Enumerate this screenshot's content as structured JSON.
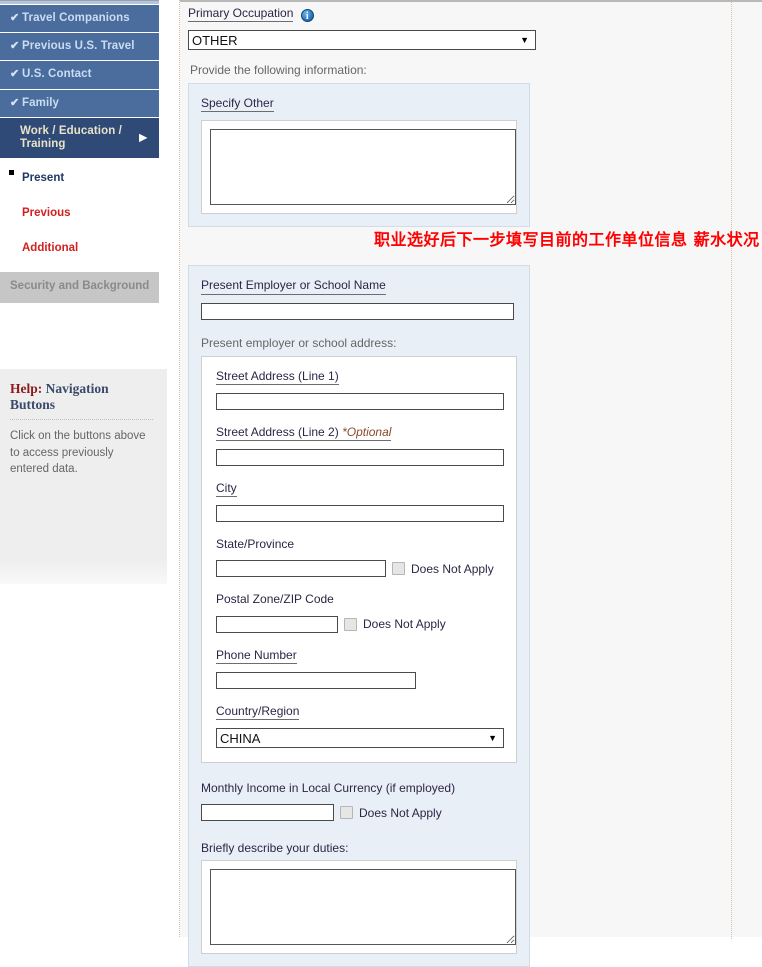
{
  "sidebar": {
    "nav_items": [
      {
        "label": "Travel Companions",
        "check": "✔",
        "state": "complete"
      },
      {
        "label": "Previous U.S. Travel",
        "check": "✔",
        "state": "complete"
      },
      {
        "label": "U.S. Contact",
        "check": "✔",
        "state": "complete"
      },
      {
        "label": "Family",
        "check": "✔",
        "state": "complete"
      },
      {
        "label": "Work / Education / Training",
        "check": "",
        "state": "active",
        "arrow": "▶"
      }
    ],
    "sub_items": [
      {
        "label": "Present",
        "current": true
      },
      {
        "label": "Previous",
        "current": false
      },
      {
        "label": "Additional",
        "current": false
      }
    ],
    "disabled_item": "Security and Background",
    "help": {
      "title_keyword": "Help:",
      "title_rest": " Navigation Buttons",
      "body": "Click on the buttons above to access previously entered data."
    }
  },
  "main": {
    "primary_occupation": {
      "label": "Primary Occupation",
      "info_icon": "i",
      "value": "OTHER",
      "caret": "▼"
    },
    "provide_hint": "Provide the following information:",
    "specify_other": {
      "label": "Specify Other",
      "value": ""
    },
    "annotation_cn": "职业选好后下一步填写目前的工作单位信息 薪水状况 及工作描述",
    "employer_name": {
      "label": "Present Employer or School Name",
      "value": ""
    },
    "address_section_label": "Present employer or school address:",
    "address": {
      "street1": {
        "label": "Street Address (Line 1)",
        "value": ""
      },
      "street2": {
        "label": "Street Address (Line 2)",
        "optional_tag": "*Optional",
        "value": ""
      },
      "city": {
        "label": "City",
        "value": ""
      },
      "state": {
        "label": "State/Province",
        "value": "",
        "dna_label": "Does Not Apply",
        "dna_checked": false
      },
      "postal": {
        "label": "Postal Zone/ZIP Code",
        "value": "",
        "dna_label": "Does Not Apply",
        "dna_checked": false
      },
      "phone": {
        "label": "Phone Number",
        "value": ""
      },
      "country": {
        "label": "Country/Region",
        "value": "CHINA",
        "caret": "▼"
      }
    },
    "monthly_income": {
      "label": "Monthly Income in Local Currency (if employed)",
      "value": "",
      "dna_label": "Does Not Apply",
      "dna_checked": false
    },
    "duties": {
      "label": "Briefly describe your duties:",
      "value": ""
    }
  },
  "colors": {
    "nav_blue": "#4a6d9e",
    "nav_active": "#2f4a77",
    "link_red": "#d02020",
    "annotation_red": "#ff0000",
    "panel_blue": "#e8eff7",
    "content_bg": "#f7f7f7"
  }
}
